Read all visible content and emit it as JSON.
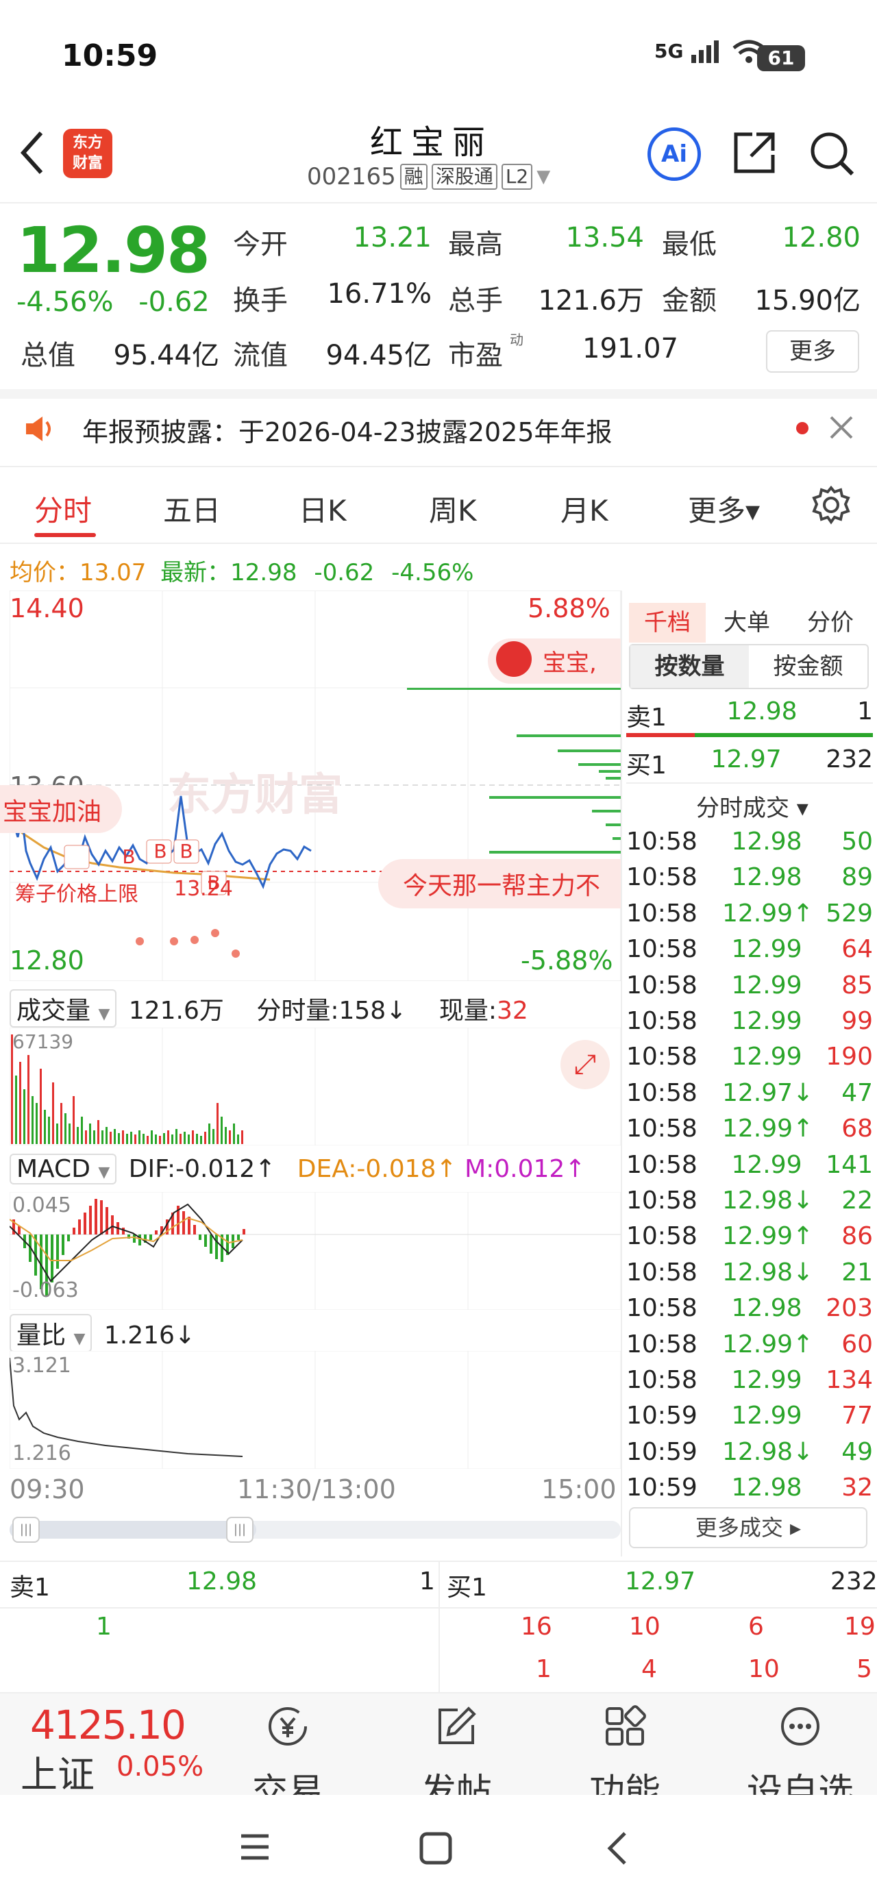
{
  "status_bar": {
    "time": "10:59",
    "signal": "5G",
    "battery": "61"
  },
  "header": {
    "logo_line1": "东方",
    "logo_line2": "财富",
    "stock_name": "红宝丽",
    "stock_code": "002165",
    "tags": [
      "融",
      "深股通",
      "L2"
    ],
    "ai_label": "Ai"
  },
  "quote": {
    "price": "12.98",
    "change_pct": "-4.56%",
    "change_amt": "-0.62",
    "fields": [
      {
        "label": "今开",
        "value": "13.21",
        "color": "#2aa52a"
      },
      {
        "label": "最高",
        "value": "13.54",
        "color": "#2aa52a"
      },
      {
        "label": "最低",
        "value": "12.80",
        "color": "#2aa52a"
      },
      {
        "label": "换手",
        "value": "16.71%",
        "color": "#222222"
      },
      {
        "label": "总手",
        "value": "121.6万",
        "color": "#222222"
      },
      {
        "label": "金额",
        "value": "15.90亿",
        "color": "#222222"
      },
      {
        "label": "总值",
        "value": "95.44亿",
        "color": "#222222"
      },
      {
        "label": "流值",
        "value": "94.45亿",
        "color": "#222222"
      },
      {
        "label": "市盈",
        "value": "191.07",
        "color": "#222222"
      }
    ],
    "pe_superscript": "动",
    "more_label": "更多"
  },
  "notice": {
    "text": "年报预披露：于2026-04-23披露2025年年报"
  },
  "tabs": [
    "分时",
    "五日",
    "日K",
    "周K",
    "月K",
    "更多▾"
  ],
  "avg_line": {
    "avg_label": "均价：",
    "avg_value": "13.07",
    "latest_label": "最新：",
    "latest_value": "12.98",
    "chg": "-0.62",
    "pct": "-4.56%"
  },
  "chart": {
    "y_max": "14.40",
    "y_min": "12.80",
    "y_mid": "13.60",
    "pct_max": "5.88%",
    "pct_min": "-5.88%",
    "watermark": "东方财富",
    "bubble_left": "宝宝加油",
    "bubble_right": "今天那一帮主力不",
    "bubble_top": "宝宝,",
    "annotation1": "筹子价格上限",
    "annotation2": "13.24",
    "b_marks": [
      "B",
      "B",
      "B",
      "B"
    ],
    "x_start": "09:30",
    "x_mid": "11:30/13:00",
    "x_end": "15:00"
  },
  "volume": {
    "label": "成交量",
    "total": "121.6万",
    "fs_label": "分时量:158↓",
    "now_label": "现量:",
    "now_value": "32",
    "max": "67139"
  },
  "macd": {
    "label": "MACD",
    "dif": "DIF:-0.012↑",
    "dea": "DEA:-0.018↑",
    "m": "M:0.012↑",
    "top": "0.045",
    "bottom": "-0.063"
  },
  "ratio": {
    "label": "量比",
    "value": "1.216↓",
    "top": "3.121",
    "bottom": "1.216"
  },
  "right_panel": {
    "tabs": [
      "千档",
      "大单",
      "分价"
    ],
    "seg": [
      "按数量",
      "按金额"
    ],
    "sell1": {
      "label": "卖1",
      "price": "12.98",
      "vol": "1"
    },
    "buy1": {
      "label": "买1",
      "price": "12.97",
      "vol": "232"
    },
    "ticks_title": "分时成交 ▾",
    "ticks": [
      {
        "t": "10:58",
        "p": "12.98",
        "v": "50",
        "pc": "#2aa52a",
        "vc": "#2aa52a"
      },
      {
        "t": "10:58",
        "p": "12.98",
        "v": "89",
        "pc": "#2aa52a",
        "vc": "#2aa52a"
      },
      {
        "t": "10:58",
        "p": "12.99↑",
        "v": "529",
        "pc": "#2aa52a",
        "vc": "#2aa52a"
      },
      {
        "t": "10:58",
        "p": "12.99",
        "v": "64",
        "pc": "#2aa52a",
        "vc": "#e2312f"
      },
      {
        "t": "10:58",
        "p": "12.99",
        "v": "85",
        "pc": "#2aa52a",
        "vc": "#e2312f"
      },
      {
        "t": "10:58",
        "p": "12.99",
        "v": "99",
        "pc": "#2aa52a",
        "vc": "#e2312f"
      },
      {
        "t": "10:58",
        "p": "12.99",
        "v": "190",
        "pc": "#2aa52a",
        "vc": "#e2312f"
      },
      {
        "t": "10:58",
        "p": "12.97↓",
        "v": "47",
        "pc": "#2aa52a",
        "vc": "#2aa52a"
      },
      {
        "t": "10:58",
        "p": "12.99↑",
        "v": "68",
        "pc": "#2aa52a",
        "vc": "#e2312f"
      },
      {
        "t": "10:58",
        "p": "12.99",
        "v": "141",
        "pc": "#2aa52a",
        "vc": "#2aa52a"
      },
      {
        "t": "10:58",
        "p": "12.98↓",
        "v": "22",
        "pc": "#2aa52a",
        "vc": "#2aa52a"
      },
      {
        "t": "10:58",
        "p": "12.99↑",
        "v": "86",
        "pc": "#2aa52a",
        "vc": "#e2312f"
      },
      {
        "t": "10:58",
        "p": "12.98↓",
        "v": "21",
        "pc": "#2aa52a",
        "vc": "#2aa52a"
      },
      {
        "t": "10:58",
        "p": "12.98",
        "v": "203",
        "pc": "#2aa52a",
        "vc": "#e2312f"
      },
      {
        "t": "10:58",
        "p": "12.99↑",
        "v": "60",
        "pc": "#2aa52a",
        "vc": "#e2312f"
      },
      {
        "t": "10:58",
        "p": "12.99",
        "v": "134",
        "pc": "#2aa52a",
        "vc": "#e2312f"
      },
      {
        "t": "10:59",
        "p": "12.99",
        "v": "77",
        "pc": "#2aa52a",
        "vc": "#e2312f"
      },
      {
        "t": "10:59",
        "p": "12.98↓",
        "v": "49",
        "pc": "#2aa52a",
        "vc": "#2aa52a"
      },
      {
        "t": "10:59",
        "p": "12.98",
        "v": "32",
        "pc": "#2aa52a",
        "vc": "#e2312f"
      }
    ],
    "more_ticks": "更多成交 ▸"
  },
  "book": {
    "sell1": {
      "label": "卖1",
      "price": "12.98",
      "vol": "1"
    },
    "buy1": {
      "label": "买1",
      "price": "12.97",
      "vol": "232"
    },
    "sell_queue": [
      "1"
    ],
    "buy_queue_row1": [
      "16",
      "10",
      "6",
      "19"
    ],
    "buy_queue_row2": [
      "1",
      "4",
      "10",
      "5"
    ]
  },
  "bottom_bar": {
    "index_value": "4125.10",
    "index_name": "上证",
    "index_pct": "0.05%",
    "items": [
      "交易",
      "发帖",
      "功能",
      "设自选"
    ]
  }
}
